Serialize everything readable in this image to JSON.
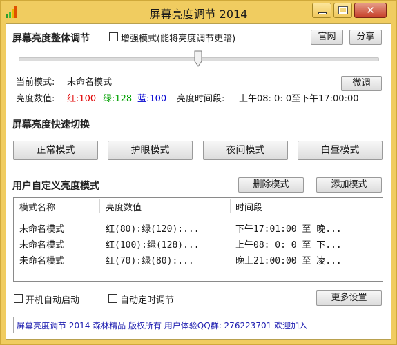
{
  "window": {
    "title": "屏幕亮度调节 2014"
  },
  "overall": {
    "heading": "屏幕亮度整体调节",
    "enhance_label": "增强模式(能将亮度调节更暗)",
    "site_button": "官网",
    "share_button": "分享",
    "slider_level": 0.5
  },
  "status": {
    "mode_label": "当前模式:",
    "mode_value": "未命名模式",
    "fine_tune_button": "微调",
    "brightness_label": "亮度数值:",
    "red": "红:100",
    "green": "绿:128",
    "blue": "蓝:100",
    "period_label": "亮度时间段:",
    "period_value": "上午08: 0: 0至下午17:00:00"
  },
  "quick": {
    "heading": "屏幕亮度快速切换",
    "buttons": [
      "正常模式",
      "护眼模式",
      "夜间模式",
      "白昼模式"
    ]
  },
  "custom": {
    "heading": "用户自定义亮度模式",
    "delete_button": "删除模式",
    "add_button": "添加模式",
    "columns": [
      "模式名称",
      "亮度数值",
      "时间段"
    ],
    "rows": [
      [
        "未命名模式",
        "红(80):绿(120):...",
        "下午17:01:00 至 晚..."
      ],
      [
        "未命名模式",
        "红(100):绿(128)...",
        "上午08: 0: 0 至 下..."
      ],
      [
        "未命名模式",
        "红(70):绿(80):...",
        "晚上21:00:00 至 凌..."
      ]
    ]
  },
  "options": {
    "autostart_label": "开机自动启动",
    "timer_label": "自动定时调节",
    "more_button": "更多设置"
  },
  "footer": {
    "text": "屏幕亮度调节 2014 森林精品 版权所有 用户体验QQ群: 276223701 欢迎加入"
  },
  "colors": {
    "frame": "#f0cc60",
    "red": "#e00000",
    "green": "#00a000",
    "blue": "#0000d0",
    "footer_text": "#1d1db0"
  }
}
